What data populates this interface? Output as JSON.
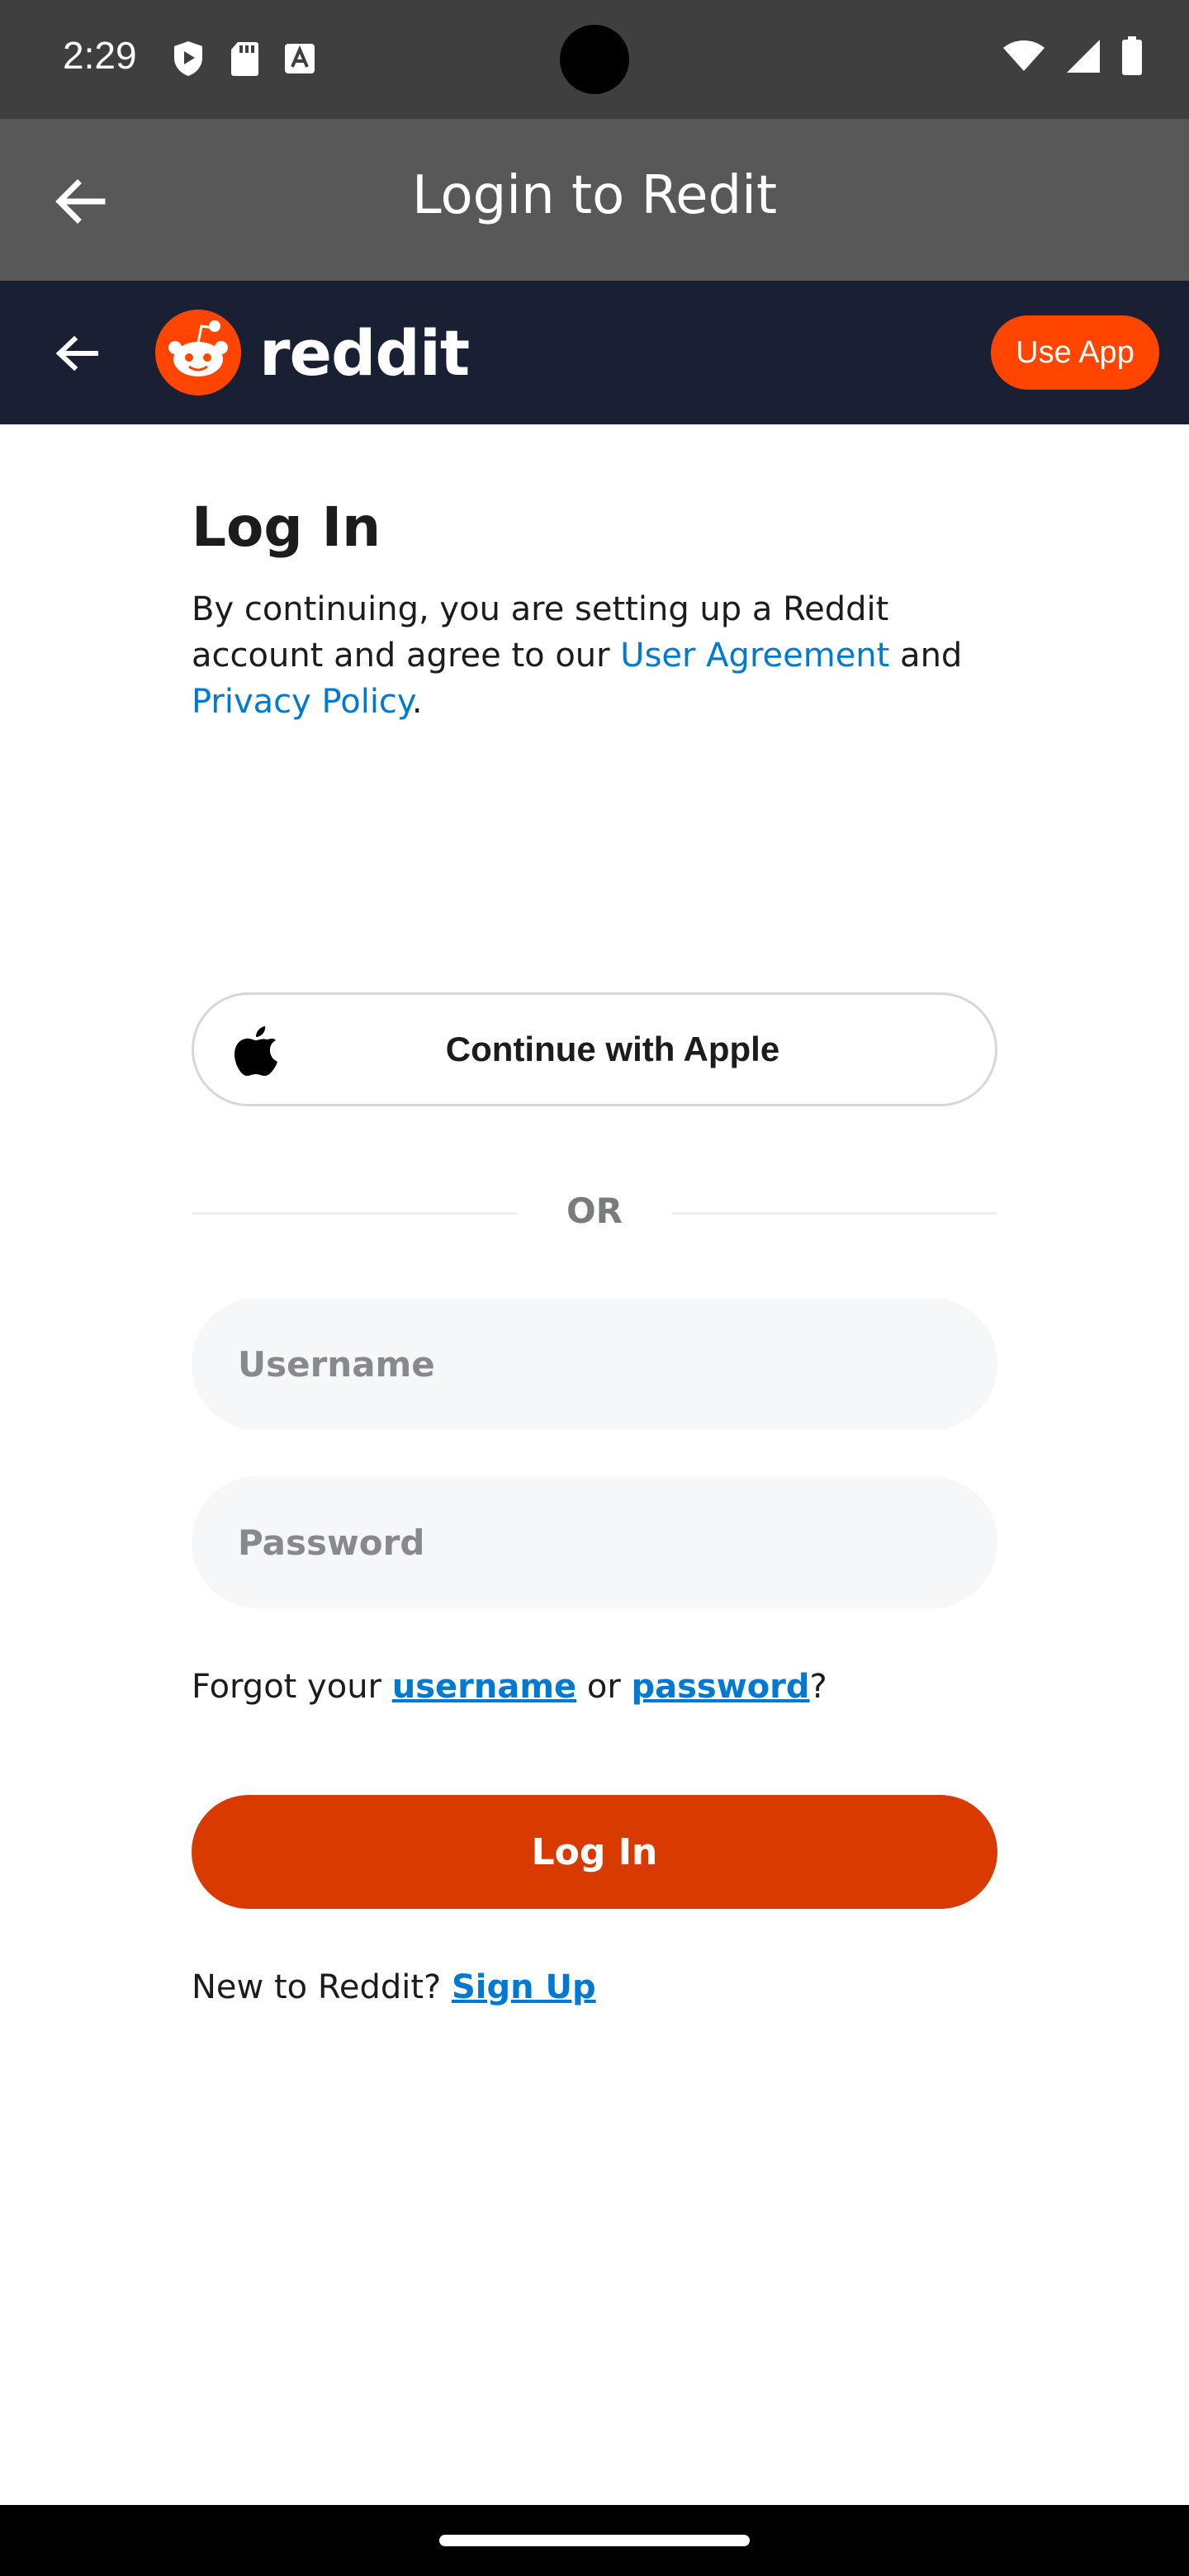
{
  "status_bar": {
    "time": "2:29",
    "left_icons": [
      "shield-icon",
      "sd-card-icon",
      "a-box-icon"
    ],
    "right_icons": [
      "wifi-icon",
      "signal-icon",
      "battery-icon"
    ]
  },
  "app_bar": {
    "title": "Login to Redit"
  },
  "reddit_header": {
    "wordmark": "reddit",
    "use_app_label": "Use App",
    "brand_color": "#ff4500",
    "background": "#1a2033"
  },
  "login": {
    "heading": "Log In",
    "agreement_prefix": "By continuing, you are setting up a Reddit account and agree to our ",
    "user_agreement_link": "User Agreement",
    "agreement_mid": " and ",
    "privacy_policy_link": "Privacy Policy",
    "agreement_suffix": ".",
    "apple_button_label": "Continue with Apple",
    "or_label": "OR",
    "username_placeholder": "Username",
    "password_placeholder": "Password",
    "forgot_prefix": "Forgot your ",
    "forgot_username_link": "username",
    "forgot_mid": " or ",
    "forgot_password_link": "password",
    "forgot_suffix": "?",
    "login_button_label": "Log In",
    "login_button_color": "#d93a00",
    "signup_prefix": "New to Reddit? ",
    "signup_link": "Sign Up",
    "link_color": "#0079d3"
  }
}
